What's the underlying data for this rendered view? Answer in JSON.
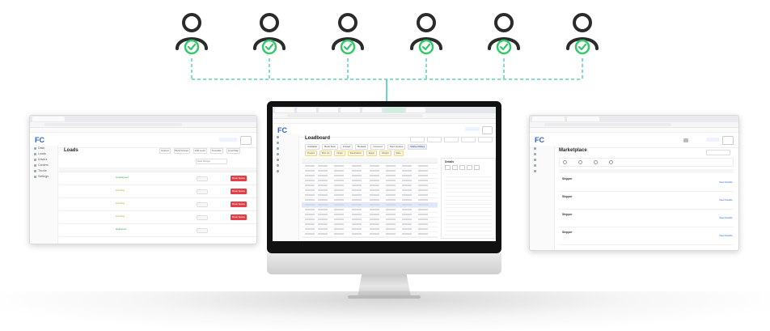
{
  "colors": {
    "accent": "#35c86b",
    "connector": "#3ec9a7",
    "user": "#2b2b2b",
    "danger": "#e0404a",
    "link": "#2f5fd0"
  },
  "users": [
    {
      "icon": "user-verified-icon"
    },
    {
      "icon": "user-verified-icon"
    },
    {
      "icon": "user-verified-icon"
    },
    {
      "icon": "user-verified-icon"
    },
    {
      "icon": "user-verified-icon"
    },
    {
      "icon": "user-verified-icon"
    }
  ],
  "left_screen": {
    "page_title": "Loads",
    "toolbar": [
      "Upload",
      "Bulk Upload",
      "Add Load",
      "Template",
      "Load Map"
    ],
    "sidebar": [
      "Dash",
      "Loads",
      "Drivers",
      "Carriers",
      "Trucks",
      "Settings"
    ],
    "rows": [
      {
        "id": "4xx",
        "status": "Unassigned",
        "action": "Book Space"
      },
      {
        "id": "4xx",
        "status": "Pending",
        "action": "Book Space"
      },
      {
        "id": "4xx",
        "status": "Pending",
        "action": "Book Space"
      },
      {
        "id": "4xx",
        "status": "Pending",
        "action": "Book Space"
      },
      {
        "id": "4xx",
        "status": "Delivered",
        "action": ""
      }
    ],
    "date_range": "Date Range"
  },
  "center_screen": {
    "page_title": "Loadboard",
    "tabs": [
      "Available",
      "Book Now",
      "Posted",
      "Booked",
      "Covered",
      "Spot Quotes",
      "Market Rates"
    ],
    "filters": [
      "Posted",
      "Pick Up",
      "Origin",
      "Destination",
      "Equip",
      "Weight",
      "Rate"
    ],
    "detail_title": "Details",
    "rows": 15,
    "highlight_row": 8
  },
  "right_screen": {
    "page_title": "Marketplace",
    "rows": [
      {
        "name": "Shipper",
        "action": "View Details"
      },
      {
        "name": "Shipper",
        "action": "View Details"
      },
      {
        "name": "Shipper",
        "action": "View Details"
      },
      {
        "name": "Shipper",
        "action": "View Details"
      }
    ]
  }
}
